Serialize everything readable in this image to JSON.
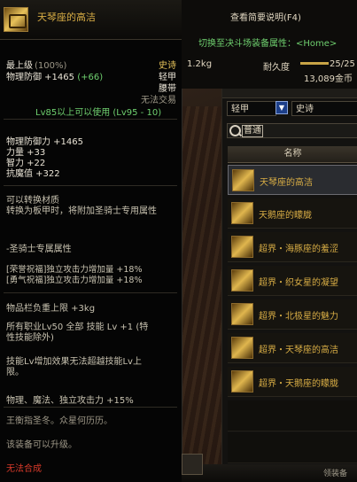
{
  "tooltip": {
    "name": "天琴座的高洁",
    "rarity": "史诗",
    "level_label": "最上级",
    "level_pct": "(100%)",
    "defense_line": "物理防御 +1465",
    "defense_bonus": "(+66)",
    "armor_type": "轻甲",
    "slot": "腰带",
    "trade": "无法交易",
    "weight": "1.2kg",
    "durability_label": "耐久度",
    "durability_value": "25/25",
    "price": "13,089金币",
    "level_req": "Lv85以上可以使用 (Lv95 - 10)",
    "stats": [
      "物理防御力 +1465",
      "力量 +33",
      "智力 +22",
      "抗魔值 +322"
    ],
    "convert_1": "可以转换材质",
    "convert_2": "转换为板甲时，将附加圣骑士专用属性",
    "paladin_attr": "-圣骑士专属属性",
    "paladin_1": "[荣誉祝福]独立攻击力增加量 +18%",
    "paladin_2": "[勇气祝福]独立攻击力增加量 +18%",
    "inventory": "物品栏负重上限 +3kg",
    "skill_line_1": "所有职业Lv50 全部 技能 Lv +1 (特",
    "skill_line_2": "性技能除外)",
    "skill_limit_1": "技能Lv增加效果无法超越技能Lv上",
    "skill_limit_2": "限。",
    "attack_bonus": "物理、魔法、独立攻击力 +15%",
    "flavor": "王衡指圣冬。众星何历历。",
    "upgrade": "该装备可以升级。",
    "no_synth": "无法合成"
  },
  "panel": {
    "desc_button": "查看简要说明(F4)",
    "switch_button": "切换至决斗场装备属性：<Home>",
    "filter_type": "轻甲",
    "filter_rarity": "史诗",
    "search_value": "普通",
    "column_header": "名称",
    "items": [
      "天琴座的高洁",
      "天鹅座的矇胧",
      "超界・海豚座的羞涩",
      "超界・织女星的凝望",
      "超界・北极星的魅力",
      "超界・天琴座的高洁",
      "超界・天鹅座的矇胧"
    ],
    "footer_btn": "领装备"
  },
  "colors": {
    "epic_gold": "#d8ad45",
    "green": "#6fd06f",
    "red": "#d83a2a"
  }
}
